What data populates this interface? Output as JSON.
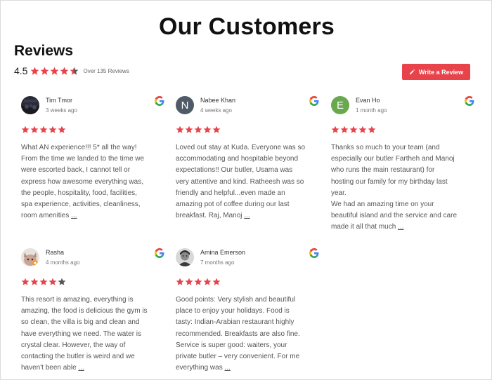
{
  "title": "Our Customers",
  "header": {
    "section_title": "Reviews",
    "rating": "4.5",
    "stars": 4.5,
    "review_count_text": "Over 135 Reviews",
    "write_review_label": "Write a Review"
  },
  "colors": {
    "star_filled": "#e8434a",
    "star_empty": "#555555",
    "button_bg": "#e8434a"
  },
  "reviews": [
    {
      "name": "Tim Tmor",
      "date": "3 weeks ago",
      "avatar_initial": "",
      "avatar_color": "#2b2b38",
      "stars": 5,
      "text": "What AN experience!!! 5* all the way!\nFrom the time we landed to the time we\nwere escorted back, I cannot tell or\nexpress how awesome everything was,\nthe people, hospitality, food, facilities,\nspa experience, activities, cleanliness,\nroom amenities ",
      "more": "..."
    },
    {
      "name": "Nabee Khan",
      "date": "4 weeks ago",
      "avatar_initial": "N",
      "avatar_color": "#4f5b66",
      "stars": 5,
      "text": "Loved out stay at Kuda. Everyone was so\naccommodating and hospitable beyond\nexpectations!! Our butler, Usama was\nvery attentive and kind. Ratheesh was so\nfriendly and helpful...even made an\namazing pot of coffee during our last\nbreakfast. Raj, Manoj ",
      "more": "..."
    },
    {
      "name": "Evan Ho",
      "date": "1 month ago",
      "avatar_initial": "E",
      "avatar_color": "#6aa84f",
      "stars": 5,
      "text": "Thanks so much to your team (and\nespecially our butler Fartheh and Manoj\nwho runs the main restaurant) for\nhosting our family for my birthday last\nyear.\nWe had an amazing time on your\nbeautiful island and the service and care\nmade it all that much ",
      "more": "..."
    },
    {
      "name": "Rasha",
      "date": "4 months ago",
      "avatar_initial": "",
      "avatar_color": "#c9b3a8",
      "stars": 4,
      "text": "This resort is amazing, everything is\namazing, the food is delicious the gym is\nso clean, the villa is big and clean and\nhave everything we need. The water is\ncrystal clear. However, the way of\ncontacting the butler is weird and we\nhaven't been able ",
      "more": "..."
    },
    {
      "name": "Amina Emerson",
      "date": "7 months ago",
      "avatar_initial": "",
      "avatar_color": "#9a9a9a",
      "stars": 5,
      "text": "Good points: Very stylish and beautiful\nplace to enjoy your holidays. Food is\ntasty: Indian-Arabian restaurant highly\nrecommended. Breakfasts are also fine.\nService is super good: waiters, your\nprivate butler – very convenient. For me\neverything was ",
      "more": "..."
    }
  ]
}
